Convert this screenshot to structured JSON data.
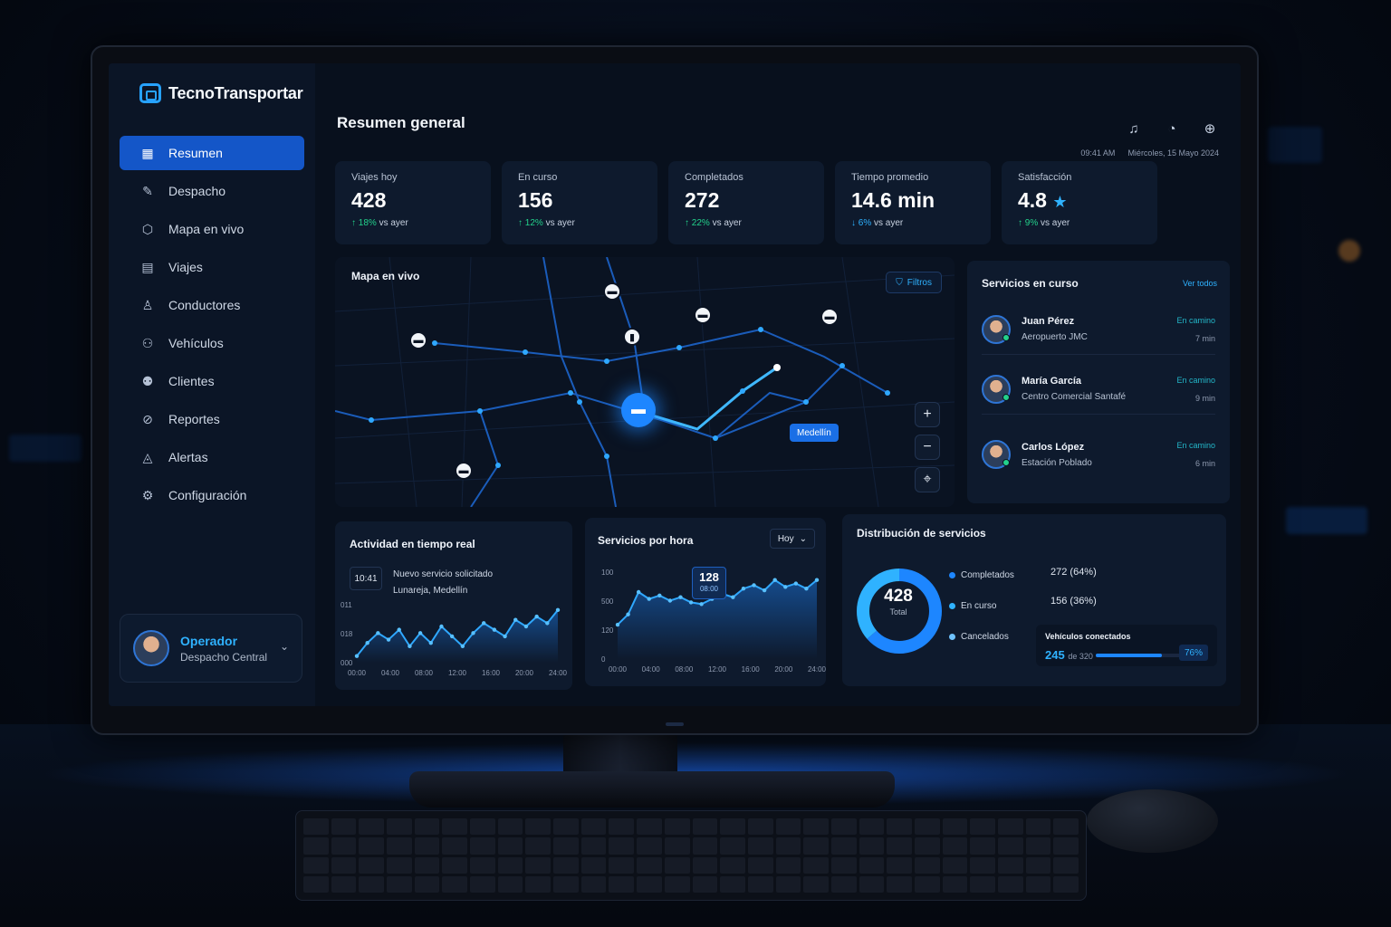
{
  "app": {
    "name": "TecnoTransportar"
  },
  "sidebar": {
    "items": [
      {
        "label": "Resumen",
        "icon": "dashboard-icon",
        "active": true
      },
      {
        "label": "Despacho",
        "icon": "dispatch-icon"
      },
      {
        "label": "Mapa en vivo",
        "icon": "map-pin-icon"
      },
      {
        "label": "Viajes",
        "icon": "map-icon"
      },
      {
        "label": "Conductores",
        "icon": "user-icon"
      },
      {
        "label": "Vehículos",
        "icon": "users-icon"
      },
      {
        "label": "Clientes",
        "icon": "clients-icon"
      },
      {
        "label": "Reportes",
        "icon": "report-icon"
      },
      {
        "label": "Alertas",
        "icon": "bell-icon"
      },
      {
        "label": "Configuración",
        "icon": "gear-icon"
      }
    ],
    "operator": {
      "name": "Operador",
      "role": "Despacho Central"
    }
  },
  "header": {
    "title": "Resumen general",
    "time": "09:41 AM",
    "date": "Miércoles, 15 Mayo 2024"
  },
  "kpis": [
    {
      "label": "Viajes hoy",
      "value": "428",
      "delta": "18%",
      "delta_suffix": "vs ayer",
      "direction": "up"
    },
    {
      "label": "En curso",
      "value": "156",
      "delta": "12%",
      "delta_suffix": "vs ayer",
      "direction": "up"
    },
    {
      "label": "Completados",
      "value": "272",
      "delta": "22%",
      "delta_suffix": "vs ayer",
      "direction": "up"
    },
    {
      "label": "Tiempo promedio",
      "value": "14.6 min",
      "delta": "6%",
      "delta_suffix": "vs ayer",
      "direction": "down"
    },
    {
      "label": "Satisfacción",
      "value": "4.8",
      "delta": "9%",
      "delta_suffix": "vs ayer",
      "direction": "up"
    }
  ],
  "map": {
    "title": "Mapa en vivo",
    "filters_label": "Filtros",
    "city_label": "Medellín"
  },
  "services": {
    "title": "Servicios en curso",
    "see_all": "Ver todos",
    "items": [
      {
        "name": "Juan Pérez",
        "place": "Aeropuerto JMC",
        "status": "En camino",
        "eta": "7 min"
      },
      {
        "name": "María García",
        "place": "Centro Comercial Santafé",
        "status": "En camino",
        "eta": "9 min"
      },
      {
        "name": "Carlos López",
        "place": "Estación Poblado",
        "status": "En camino",
        "eta": "6 min"
      }
    ]
  },
  "activity": {
    "title": "Actividad en tiempo real",
    "time": "10:41",
    "line1": "Nuevo servicio solicitado",
    "line2": "Lunareja, Medellín"
  },
  "hourly": {
    "title": "Servicios por hora",
    "range": "Hoy",
    "tooltip_value": "128",
    "tooltip_time": "08:00"
  },
  "distribution": {
    "title": "Distribución de servicios",
    "total": "428",
    "total_label": "Total",
    "legend": [
      {
        "label": "Completados",
        "value": "272 (64%)",
        "color": "#1d86ff"
      },
      {
        "label": "En curso",
        "value": "156 (36%)",
        "color": "#2fb2ff"
      },
      {
        "label": "Cancelados",
        "value": "",
        "color": "#6fc3ff"
      }
    ],
    "vehicles": {
      "title": "Vehículos conectados",
      "count": "245",
      "of": "de 320",
      "pct": "76%",
      "fraction": 0.76
    }
  },
  "chart_data": [
    {
      "type": "area",
      "title": "Actividad en tiempo real",
      "categories": [
        "00:00",
        "04:00",
        "08:00",
        "12:00",
        "16:00",
        "20:00",
        "24:00"
      ],
      "y_ticks": [
        "000",
        "018",
        "011"
      ],
      "values": [
        2,
        6,
        9,
        7,
        10,
        5,
        9,
        6,
        11,
        8,
        5,
        9,
        12,
        10,
        8,
        13,
        11,
        14,
        12,
        16
      ]
    },
    {
      "type": "area",
      "title": "Servicios por hora",
      "categories": [
        "00:00",
        "04:00",
        "08:00",
        "12:00",
        "16:00",
        "20:00",
        "24:00"
      ],
      "y_ticks": [
        "0",
        "120",
        "500",
        "100"
      ],
      "values": [
        40,
        52,
        78,
        70,
        74,
        68,
        72,
        66,
        64,
        70,
        76,
        72,
        82,
        86,
        80,
        92,
        84,
        88,
        82,
        92
      ]
    },
    {
      "type": "pie",
      "title": "Distribución de servicios",
      "categories": [
        "Completados",
        "En curso"
      ],
      "values": [
        272,
        156
      ]
    }
  ]
}
